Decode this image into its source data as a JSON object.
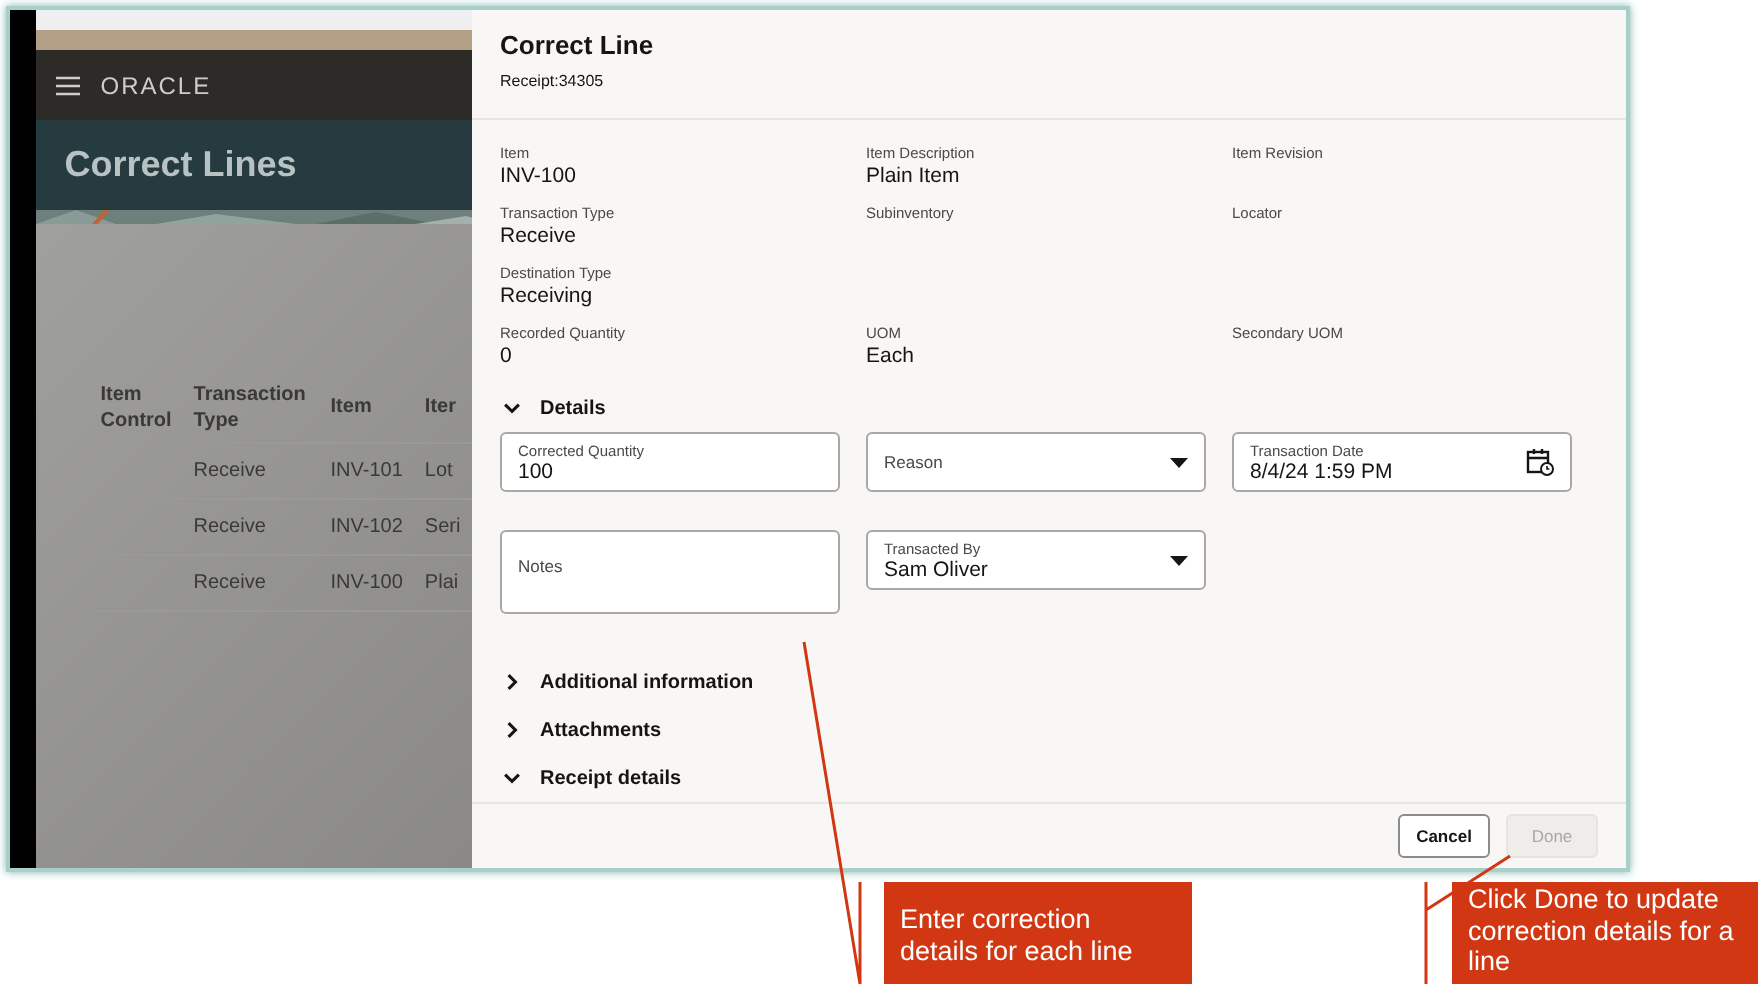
{
  "background_page": {
    "logo": "ORACLE",
    "page_title": "Correct Lines",
    "table": {
      "columns": [
        "Item Control",
        "Transaction Type",
        "Item",
        "Iter"
      ],
      "rows": [
        {
          "transaction_type": "Receive",
          "item": "INV-101",
          "column_4": "Lot"
        },
        {
          "transaction_type": "Receive",
          "item": "INV-102",
          "column_4": "Seri"
        },
        {
          "transaction_type": "Receive",
          "item": "INV-100",
          "column_4": "Plai"
        }
      ]
    }
  },
  "drawer": {
    "title": "Correct Line",
    "subtitle": "Receipt:34305",
    "field_rows": [
      [
        {
          "label": "Item",
          "value": "INV-100"
        },
        {
          "label": "Item Description",
          "value": "Plain Item"
        },
        {
          "label": "Item Revision"
        }
      ],
      [
        {
          "label": "Transaction Type",
          "value": "Receive"
        },
        {
          "label": "Subinventory"
        },
        {
          "label": "Locator"
        }
      ],
      [
        {
          "label": "Destination Type",
          "value": "Receiving"
        }
      ],
      [
        {
          "label": "Recorded Quantity",
          "value": "0"
        },
        {
          "label": "UOM",
          "value": "Each"
        },
        {
          "label": "Secondary UOM"
        }
      ]
    ],
    "sections": [
      {
        "title": "Details",
        "expanded": true,
        "controls": [
          {
            "kind": "text",
            "label": "Corrected Quantity",
            "value": "100"
          },
          {
            "kind": "select",
            "placeholder": "Reason"
          },
          {
            "kind": "date",
            "label": "Transaction Date",
            "value": "8/4/24 1:59 PM"
          },
          {
            "kind": "textarea",
            "placeholder": "Notes"
          },
          {
            "kind": "select",
            "label": "Transacted By",
            "value": "Sam Oliver"
          }
        ]
      },
      {
        "title": "Additional information",
        "expanded": false
      },
      {
        "title": "Attachments",
        "expanded": false
      },
      {
        "title": "Receipt details",
        "expanded": true
      }
    ],
    "buttons": [
      {
        "label": "Cancel",
        "disabled": false
      },
      {
        "label": "Done",
        "disabled": true
      }
    ]
  },
  "callouts": [
    "Enter correction details for each line",
    "Click Done to update correction details for a line"
  ]
}
